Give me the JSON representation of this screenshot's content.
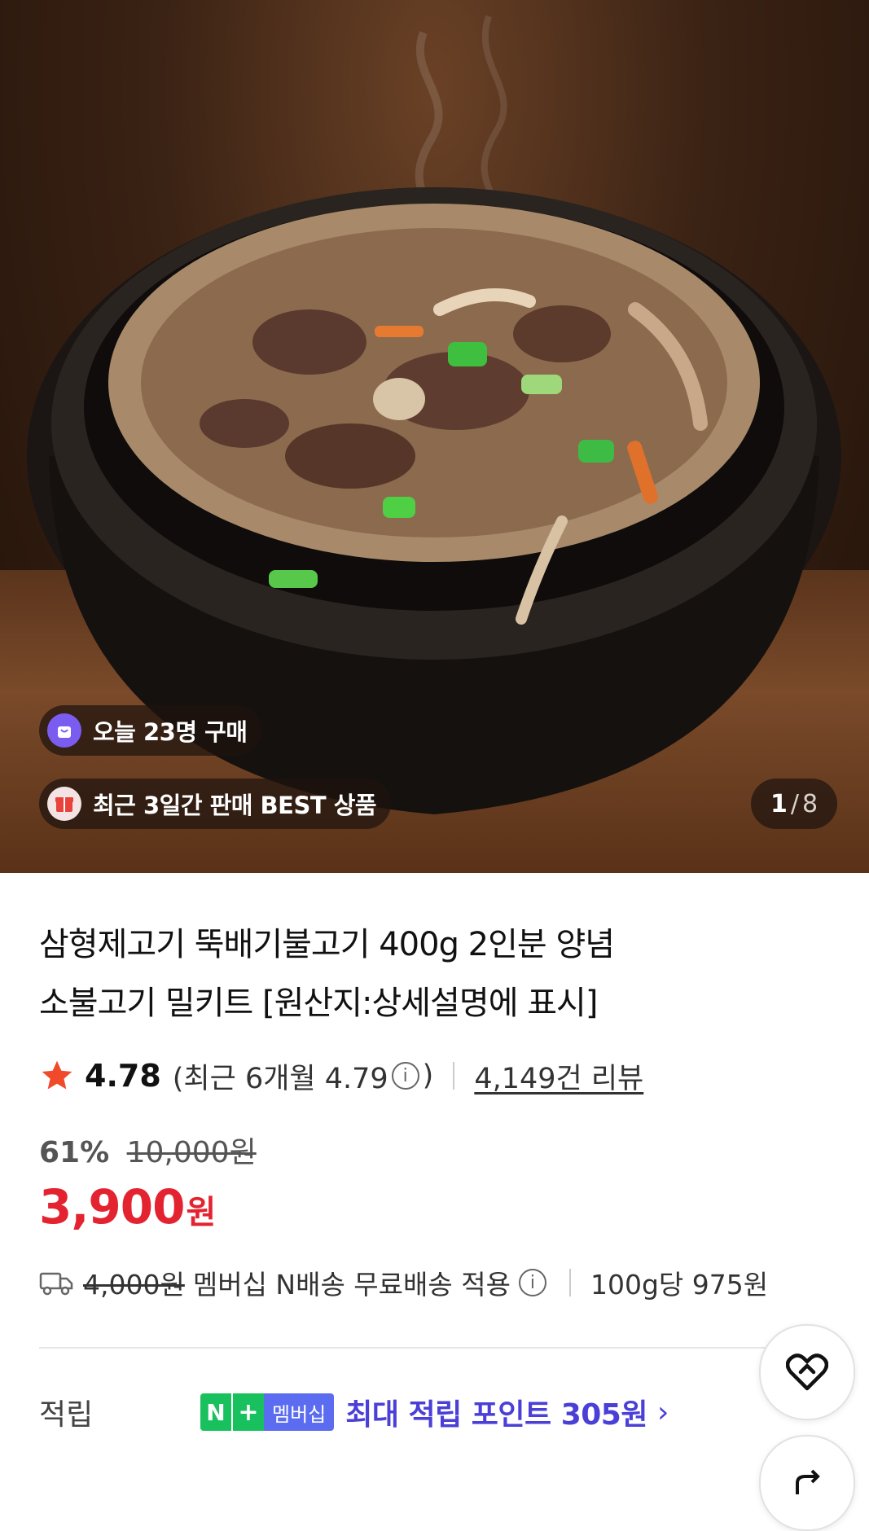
{
  "hero": {
    "badges": [
      {
        "icon": "shopping-bag-icon",
        "text": "오늘 23명 구매"
      },
      {
        "icon": "gift-box-icon",
        "text": "최근 3일간 판매 BEST 상품"
      }
    ],
    "pager": {
      "current": "1",
      "separator": "/",
      "total": "8"
    }
  },
  "product": {
    "title_line1": "삼형제고기 뚝배기불고기 400g 2인분 양념",
    "title_line2": "소불고기 밀키트 [원산지:상세설명에 표시]",
    "rating": {
      "score": "4.78",
      "recent_prefix": "(최근 6개월 4.79",
      "recent_suffix": ")",
      "info_glyph": "i",
      "reviews": "4,149건 리뷰"
    },
    "discount_pct": "61%",
    "original_price": "10,000원",
    "price_amount": "3,900",
    "price_unit": "원",
    "shipping": {
      "original_fee": "4,000원",
      "text": "멤버십 N배송 무료배송 적용",
      "info_glyph": "i",
      "unit_price": "100g당 975원"
    },
    "points": {
      "label": "적립",
      "badge_n": "N",
      "badge_plus": "+",
      "badge_member": "멤버십",
      "text": "최대 적립 포인트 305원",
      "chevron": "›"
    }
  },
  "colors": {
    "price_red": "#e3232f",
    "points_blue": "#4a3fd6",
    "badge_green": "#19c15e",
    "badge_blue": "#5b6cf0",
    "star": "#f04a2a"
  }
}
